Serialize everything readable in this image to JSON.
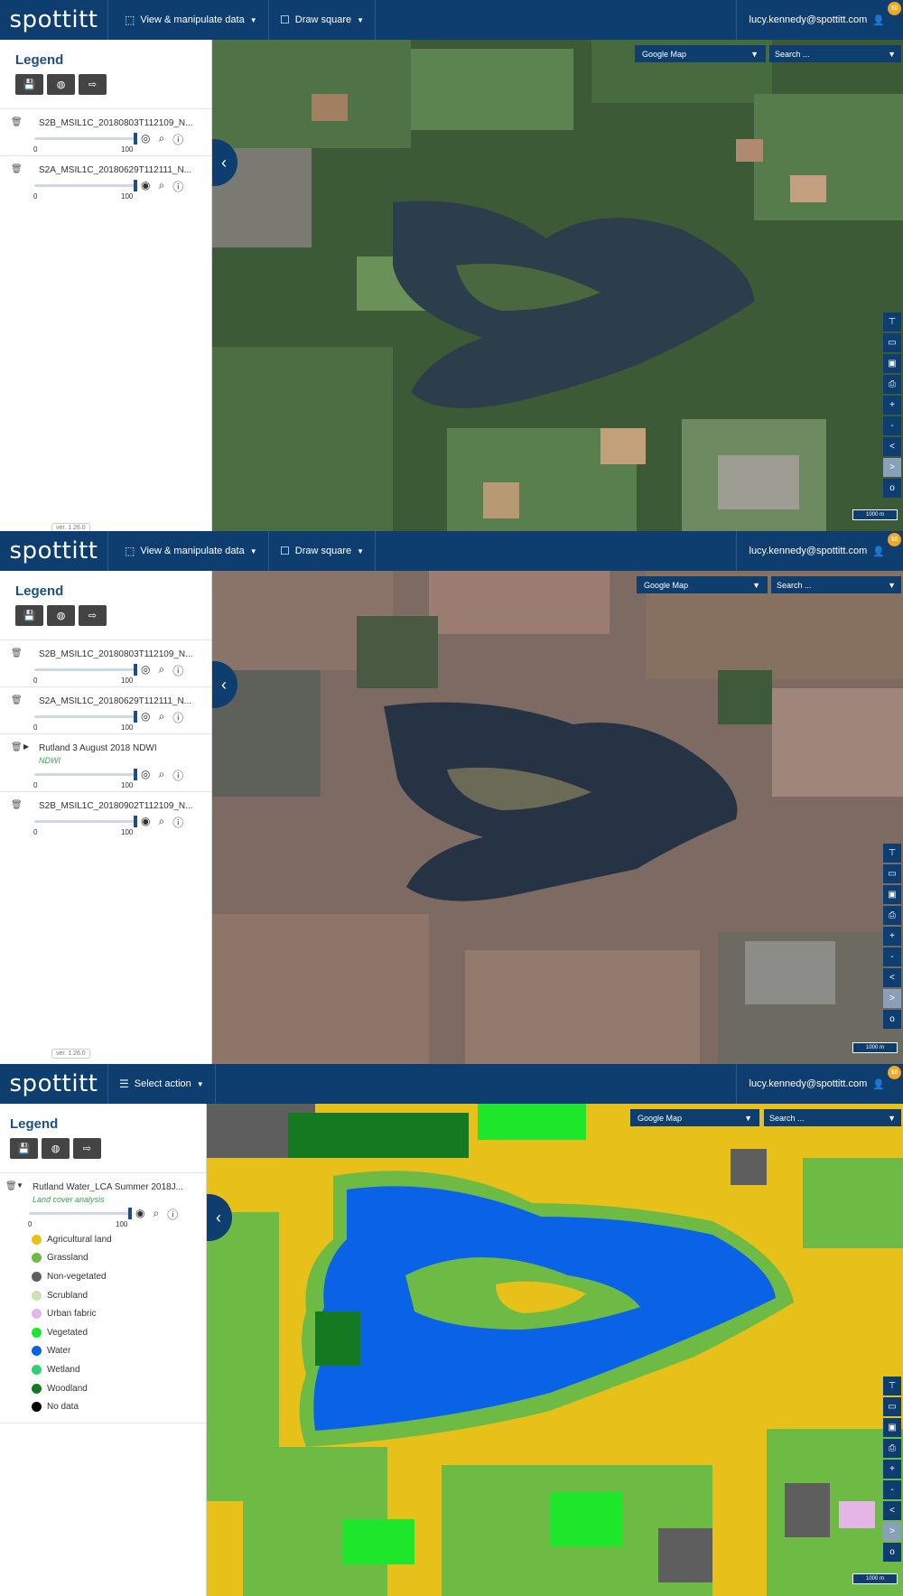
{
  "app": {
    "logo": "spottitt",
    "user_email": "lucy.kennedy@spottitt.com",
    "notification_count": "10",
    "version": "ver. 1.26.0"
  },
  "menus": {
    "view_manipulate": "View & manipulate data",
    "draw_square": "Draw square",
    "select_action": "Select action"
  },
  "legend": {
    "title": "Legend",
    "slider_min": "0",
    "slider_max": "100"
  },
  "map": {
    "basemap": "Google Map",
    "search_placeholder": "Search ...",
    "scale": "1000 m"
  },
  "panel1": {
    "layers": [
      {
        "name": "S2B_MSIL1C_20180803T112109_N..."
      },
      {
        "name": "S2A_MSIL1C_20180629T112111_N..."
      }
    ]
  },
  "panel2": {
    "layers": [
      {
        "name": "S2B_MSIL1C_20180803T112109_N..."
      },
      {
        "name": "S2A_MSIL1C_20180629T112111_N..."
      },
      {
        "name": "Rutland 3 August 2018 NDWI",
        "sub": "NDWI"
      },
      {
        "name": "S2B_MSIL1C_20180902T112109_N..."
      }
    ]
  },
  "panel3": {
    "layer_name": "Rutland Water_LCA Summer 2018J...",
    "layer_sub": "Land cover analysis",
    "classes": [
      {
        "label": "Agricultural land",
        "color": "#e8c01a"
      },
      {
        "label": "Grassland",
        "color": "#6dbb45"
      },
      {
        "label": "Non-vegetated",
        "color": "#5e5e5e"
      },
      {
        "label": "Scrubland",
        "color": "#cfe0b4"
      },
      {
        "label": "Urban fabric",
        "color": "#e4b6e6"
      },
      {
        "label": "Vegetated",
        "color": "#1ee62a"
      },
      {
        "label": "Water",
        "color": "#0a62e6"
      },
      {
        "label": "Wetland",
        "color": "#2fcf7a"
      },
      {
        "label": "Woodland",
        "color": "#137a22"
      },
      {
        "label": "No data",
        "color": "#000000"
      }
    ]
  }
}
